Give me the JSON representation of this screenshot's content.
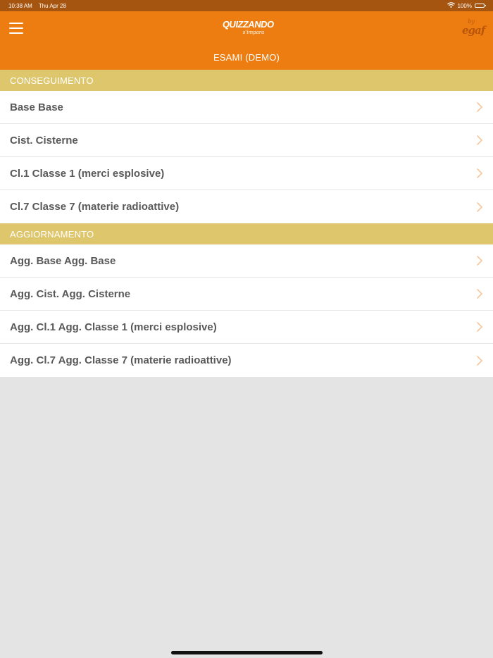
{
  "status_bar": {
    "time": "10:38 AM",
    "date": "Thu Apr 28",
    "battery": "100%"
  },
  "header": {
    "logo_main": "QUIZZANDO",
    "logo_sub": "s'impara",
    "brand_by": "by",
    "brand_name": "egaf",
    "title": "ESAMI (DEMO)"
  },
  "sections": [
    {
      "title": "CONSEGUIMENTO",
      "items": [
        {
          "label": "Base Base"
        },
        {
          "label": "Cist. Cisterne"
        },
        {
          "label": "Cl.1 Classe 1 (merci esplosive)"
        },
        {
          "label": "Cl.7 Classe 7 (materie radioattive)"
        }
      ]
    },
    {
      "title": "AGGIORNAMENTO",
      "items": [
        {
          "label": "Agg. Base Agg. Base"
        },
        {
          "label": "Agg. Cist. Agg. Cisterne"
        },
        {
          "label": "Agg. Cl.1 Agg. Classe 1 (merci esplosive)"
        },
        {
          "label": "Agg. Cl.7 Agg. Classe 7 (materie radioattive)"
        }
      ]
    }
  ],
  "colors": {
    "header": "#ee7d11",
    "status_bar": "#a5550f",
    "section_header": "#dec66c",
    "chevron": "#f6c79c",
    "row_text": "#595959"
  },
  "icons": {
    "menu": "hamburger-menu-icon",
    "chevron": "chevron-right-icon",
    "wifi": "wifi-icon",
    "battery": "battery-icon"
  }
}
